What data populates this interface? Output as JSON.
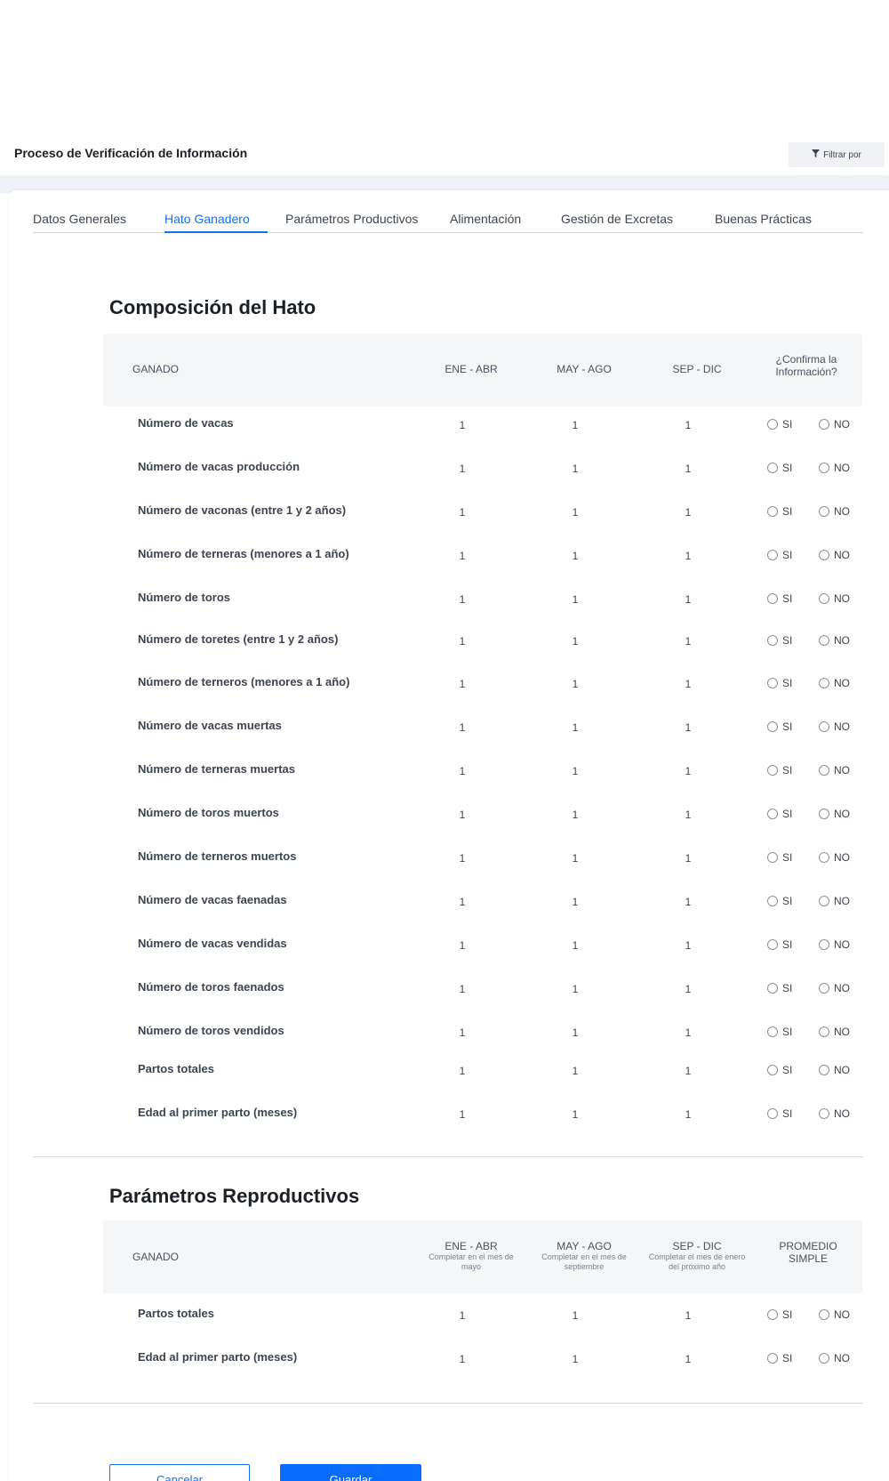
{
  "header": {
    "title": "Proceso de Verificación de Información",
    "filter_label": "Filtrar por",
    "filter_icon": "funnel-icon"
  },
  "tabs": [
    {
      "label": "Datos Generales",
      "active": false
    },
    {
      "label": "Hato Ganadero",
      "active": true
    },
    {
      "label": "Parámetros Productivos",
      "active": false
    },
    {
      "label": "Alimentación",
      "active": false
    },
    {
      "label": "Gestión de Excretas",
      "active": false
    },
    {
      "label": "Buenas Prácticas",
      "active": false
    }
  ],
  "composicion": {
    "title": "Composición del Hato",
    "headers": {
      "ganado": "GANADO",
      "p1": "ENE - ABR",
      "p2": "MAY - AGO",
      "p3": "SEP - DIC",
      "confirm": "¿Confirma la Información?"
    },
    "rows": [
      {
        "label": "Número de vacas",
        "values": [
          "1",
          "1",
          "1"
        ]
      },
      {
        "label": "Número de vacas producción",
        "values": [
          "1",
          "1",
          "1"
        ]
      },
      {
        "label": "Número de vaconas (entre 1 y 2 años)",
        "values": [
          "1",
          "1",
          "1"
        ]
      },
      {
        "label": "Número de terneras (menores a 1 año)",
        "values": [
          "1",
          "1",
          "1"
        ]
      },
      {
        "label": "Número de toros",
        "values": [
          "1",
          "1",
          "1"
        ]
      },
      {
        "label": "Número de toretes (entre 1 y 2 años)",
        "values": [
          "1",
          "1",
          "1"
        ]
      },
      {
        "label": "Número de terneros (menores a 1 año)",
        "values": [
          "1",
          "1",
          "1"
        ]
      },
      {
        "label": "Número de vacas muertas",
        "values": [
          "1",
          "1",
          "1"
        ]
      },
      {
        "label": "Número de terneras muertas",
        "values": [
          "1",
          "1",
          "1"
        ]
      },
      {
        "label": "Número de toros muertos",
        "values": [
          "1",
          "1",
          "1"
        ]
      },
      {
        "label": "Número de terneros muertos",
        "values": [
          "1",
          "1",
          "1"
        ]
      },
      {
        "label": "Número de vacas faenadas",
        "values": [
          "1",
          "1",
          "1"
        ]
      },
      {
        "label": "Número de vacas vendidas",
        "values": [
          "1",
          "1",
          "1"
        ]
      },
      {
        "label": "Número de toros faenados",
        "values": [
          "1",
          "1",
          "1"
        ]
      },
      {
        "label": "Número de toros vendidos",
        "values": [
          "1",
          "1",
          "1"
        ]
      },
      {
        "label": "Partos totales",
        "values": [
          "1",
          "1",
          "1"
        ]
      },
      {
        "label": "Edad al primer parto (meses)",
        "values": [
          "1",
          "1",
          "1"
        ]
      }
    ]
  },
  "reproductivos": {
    "title": "Parámetros Reproductivos",
    "headers": {
      "ganado": "GANADO",
      "p1": "ENE - ABR",
      "p1_sub": "Completar en el mes de mayo",
      "p2": "MAY - AGO",
      "p2_sub": "Completar en el mes de septiembre",
      "p3": "SEP - DIC",
      "p3_sub": "Completar el mes de enero del próximo año",
      "avg": "PROMEDIO SIMPLE"
    },
    "rows": [
      {
        "label": "Partos totales",
        "values": [
          "1",
          "1",
          "1"
        ]
      },
      {
        "label": "Edad al primer parto (meses)",
        "values": [
          "1",
          "1",
          "1"
        ]
      }
    ]
  },
  "radio_labels": {
    "yes": "SI",
    "no": "NO"
  },
  "actions": {
    "cancel": "Cancelar",
    "save": "Guardar"
  },
  "colors": {
    "accent": "#1570ef",
    "primary_button": "#0a6cff",
    "header_bg": "#f5f6f8"
  }
}
